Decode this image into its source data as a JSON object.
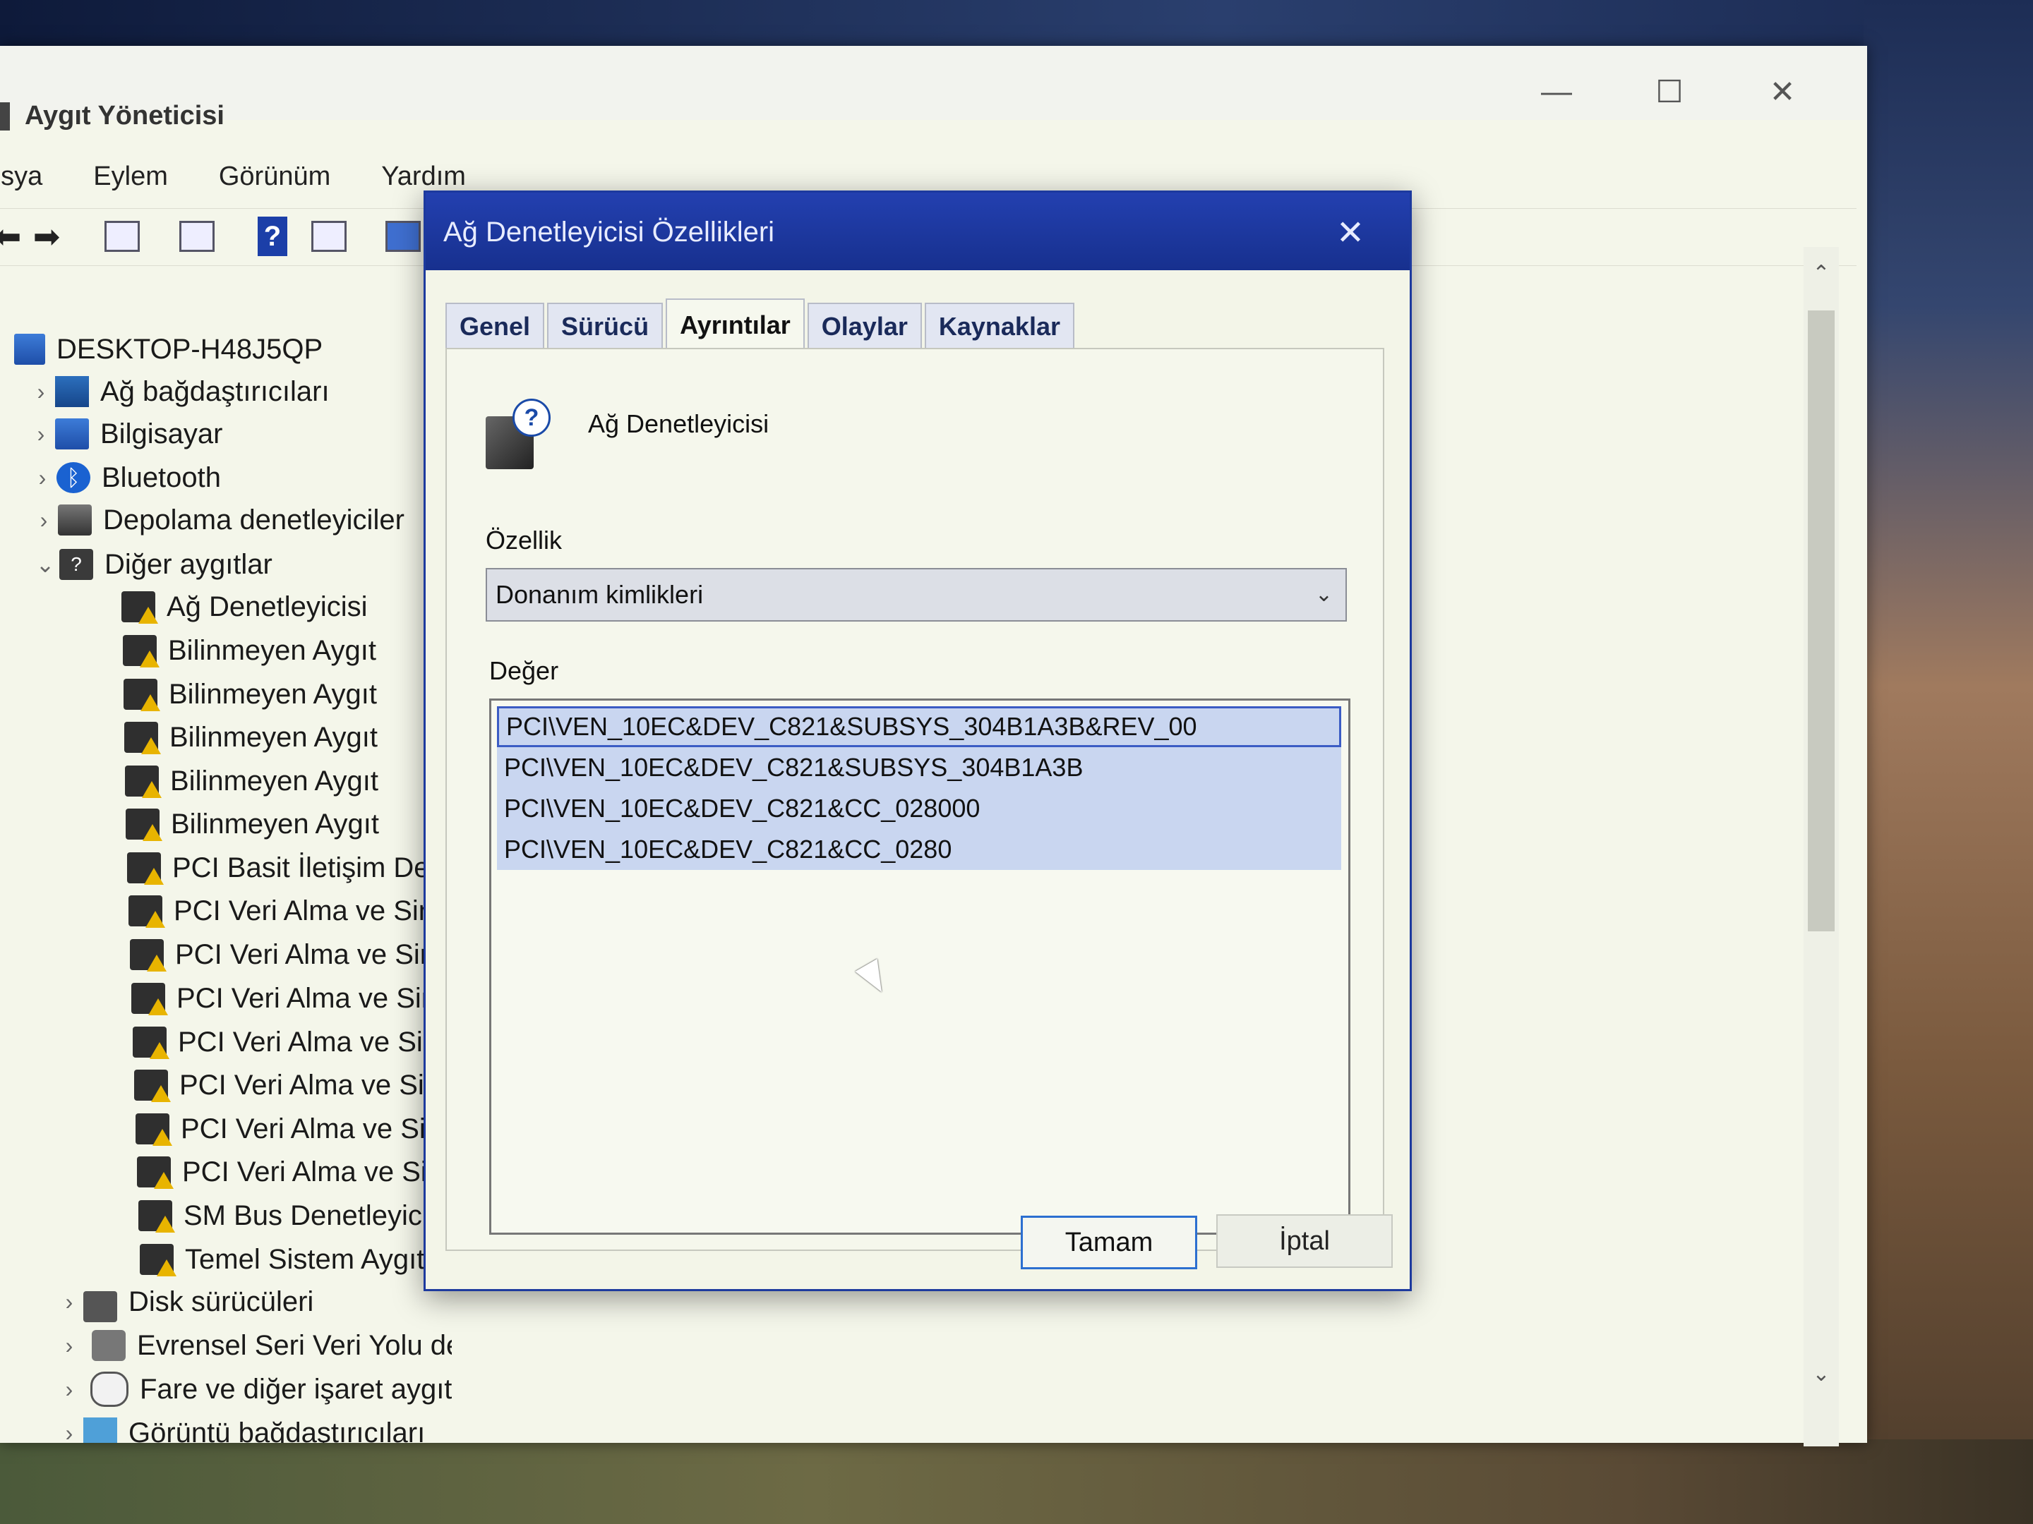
{
  "window": {
    "title": "Aygıt Yöneticisi",
    "controls": {
      "minimize": "—",
      "maximize": "☐",
      "close": "✕"
    }
  },
  "menu": [
    "osya",
    "Eylem",
    "Görünüm",
    "Yardım"
  ],
  "tree": {
    "root": "DESKTOP-H48J5QP",
    "items": [
      {
        "label": "Ağ bağdaştırıcıları",
        "icon": "network-adapter-icon",
        "chevron": "›"
      },
      {
        "label": "Bilgisayar",
        "icon": "computer-icon",
        "chevron": "›"
      },
      {
        "label": "Bluetooth",
        "icon": "bluetooth-icon",
        "chevron": "›"
      },
      {
        "label": "Depolama denetleyiciler",
        "icon": "storage-icon",
        "chevron": "›"
      },
      {
        "label": "Diğer aygıtlar",
        "icon": "other-devices-icon",
        "chevron": "⌄"
      },
      {
        "label": "Ağ Denetleyicisi",
        "icon": "warning-device-icon"
      },
      {
        "label": "Bilinmeyen Aygıt",
        "icon": "warning-device-icon"
      },
      {
        "label": "Bilinmeyen Aygıt",
        "icon": "warning-device-icon"
      },
      {
        "label": "Bilinmeyen Aygıt",
        "icon": "warning-device-icon"
      },
      {
        "label": "Bilinmeyen Aygıt",
        "icon": "warning-device-icon"
      },
      {
        "label": "Bilinmeyen Aygıt",
        "icon": "warning-device-icon"
      },
      {
        "label": "PCI Basit İletişim Der",
        "icon": "warning-device-icon"
      },
      {
        "label": "PCI Veri Alma ve Siny",
        "icon": "warning-device-icon"
      },
      {
        "label": "PCI Veri Alma ve Siny",
        "icon": "warning-device-icon"
      },
      {
        "label": "PCI Veri Alma ve Siny",
        "icon": "warning-device-icon"
      },
      {
        "label": "PCI Veri Alma ve Siny",
        "icon": "warning-device-icon"
      },
      {
        "label": "PCI Veri Alma ve Siny",
        "icon": "warning-device-icon"
      },
      {
        "label": "PCI Veri Alma ve Siny",
        "icon": "warning-device-icon"
      },
      {
        "label": "PCI Veri Alma ve Siny",
        "icon": "warning-device-icon"
      },
      {
        "label": "SM Bus Denetleyicisi",
        "icon": "warning-device-icon"
      },
      {
        "label": "Temel Sistem Aygıtı",
        "icon": "warning-device-icon"
      },
      {
        "label": "Disk sürücüleri",
        "icon": "disk-icon",
        "chevron": "›"
      },
      {
        "label": "Evrensel Seri Veri Yolu de",
        "icon": "usb-icon",
        "chevron": "›"
      },
      {
        "label": "Fare ve diğer işaret aygıtları",
        "icon": "mouse-icon",
        "chevron": "›"
      },
      {
        "label": "Görüntü bağdaştırıcıları",
        "icon": "display-icon",
        "chevron": "›"
      }
    ]
  },
  "dialog": {
    "title": "Ağ Denetleyicisi Özellikleri",
    "close": "✕",
    "tabs": [
      "Genel",
      "Sürücü",
      "Ayrıntılar",
      "Olaylar",
      "Kaynaklar"
    ],
    "active_tab": "Ayrıntılar",
    "device_name": "Ağ Denetleyicisi",
    "property_label": "Özellik",
    "property_value": "Donanım kimlikleri",
    "value_label": "Değer",
    "values": [
      "PCI\\VEN_10EC&DEV_C821&SUBSYS_304B1A3B&REV_00",
      "PCI\\VEN_10EC&DEV_C821&SUBSYS_304B1A3B",
      "PCI\\VEN_10EC&DEV_C821&CC_028000",
      "PCI\\VEN_10EC&DEV_C821&CC_0280"
    ],
    "ok_label": "Tamam",
    "cancel_label": "İptal"
  },
  "colors": {
    "dialog_titlebar": "#2340b0",
    "selection": "#c9d6f0",
    "warning": "#e8b400"
  }
}
